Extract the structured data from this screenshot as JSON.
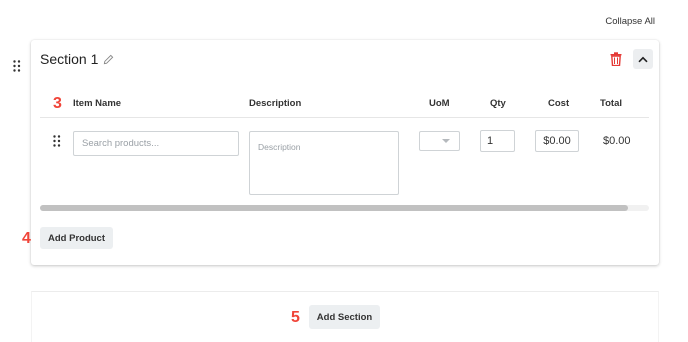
{
  "header": {
    "collapse_all_label": "Collapse All"
  },
  "section": {
    "title": "Section 1",
    "columns": [
      "Item Name",
      "Description",
      "UoM",
      "Qty",
      "Cost",
      "Total"
    ],
    "row": {
      "item_placeholder": "Search products...",
      "description_placeholder": "Description",
      "uom_value": "",
      "qty_value": "1",
      "cost_value": "$0.00",
      "total_value": "$0.00"
    },
    "horizontal_scroll_fraction": 0.965,
    "add_product_label": "Add Product"
  },
  "add_section_label": "Add Section",
  "markers": {
    "m3": "3",
    "m4": "4",
    "m5": "5"
  },
  "colors": {
    "marker": "#f04438",
    "trash": "#e53935",
    "button_bg": "#eceff1"
  },
  "icons": [
    "drag-handle-icon",
    "pencil-icon",
    "trash-icon",
    "chevron-up-icon",
    "caret-down-icon"
  ]
}
